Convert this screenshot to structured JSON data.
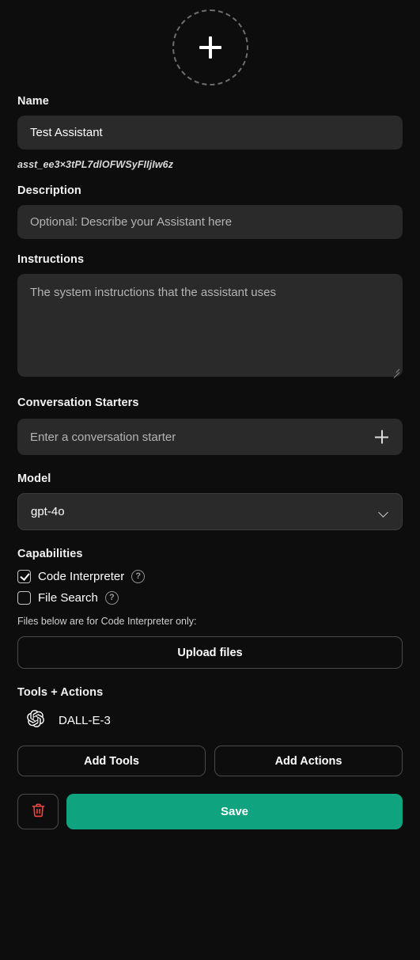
{
  "avatar": {
    "icon": "plus-icon",
    "alt": "Add assistant image"
  },
  "name_section": {
    "label": "Name",
    "value": "Test Assistant",
    "assistant_id": "asst_ee3×3tPL7dlOFWSyFIIjIw6z"
  },
  "description_section": {
    "label": "Description",
    "value": "",
    "placeholder": "Optional: Describe your Assistant here"
  },
  "instructions_section": {
    "label": "Instructions",
    "value": "",
    "placeholder": "The system instructions that the assistant uses",
    "resize_handle": "resize-grip-icon"
  },
  "conversation_starters": {
    "label": "Conversation Starters",
    "value": "",
    "placeholder": "Enter a conversation starter",
    "add_icon": "plus-icon"
  },
  "model": {
    "label": "Model",
    "selected": "gpt-4o",
    "options": [
      "gpt-4o"
    ],
    "chevron": "chevron-down-icon"
  },
  "capabilities": {
    "label": "Capabilities",
    "items": [
      {
        "label": "Code Interpreter",
        "checked": true,
        "help": "?"
      },
      {
        "label": "File Search",
        "checked": false,
        "help": "?"
      }
    ],
    "note": "Files below are for Code Interpreter only:",
    "upload_label": "Upload files"
  },
  "tools_actions": {
    "label": "Tools + Actions",
    "tools": [
      {
        "name": "DALL-E-3",
        "icon": "openai-logo-icon"
      }
    ],
    "add_tools_label": "Add Tools",
    "add_actions_label": "Add Actions"
  },
  "footer": {
    "delete_icon": "trash-icon",
    "save_label": "Save"
  },
  "colors": {
    "background": "#0d0d0d",
    "field": "#2a2a2a",
    "accent_save": "#10a37f",
    "danger": "#ef4444"
  }
}
